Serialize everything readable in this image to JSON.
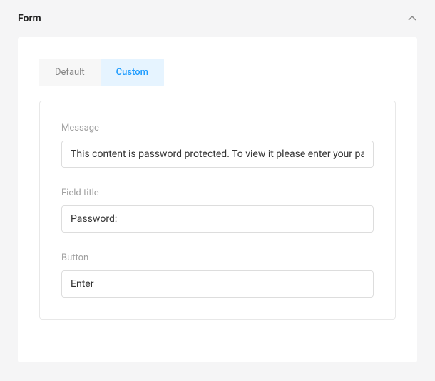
{
  "panel": {
    "title": "Form"
  },
  "tabs": {
    "default": "Default",
    "custom": "Custom"
  },
  "form": {
    "message": {
      "label": "Message",
      "value": "This content is password protected. To view it please enter your password below:"
    },
    "field_title": {
      "label": "Field title",
      "value": "Password:"
    },
    "button": {
      "label": "Button",
      "value": "Enter"
    }
  }
}
